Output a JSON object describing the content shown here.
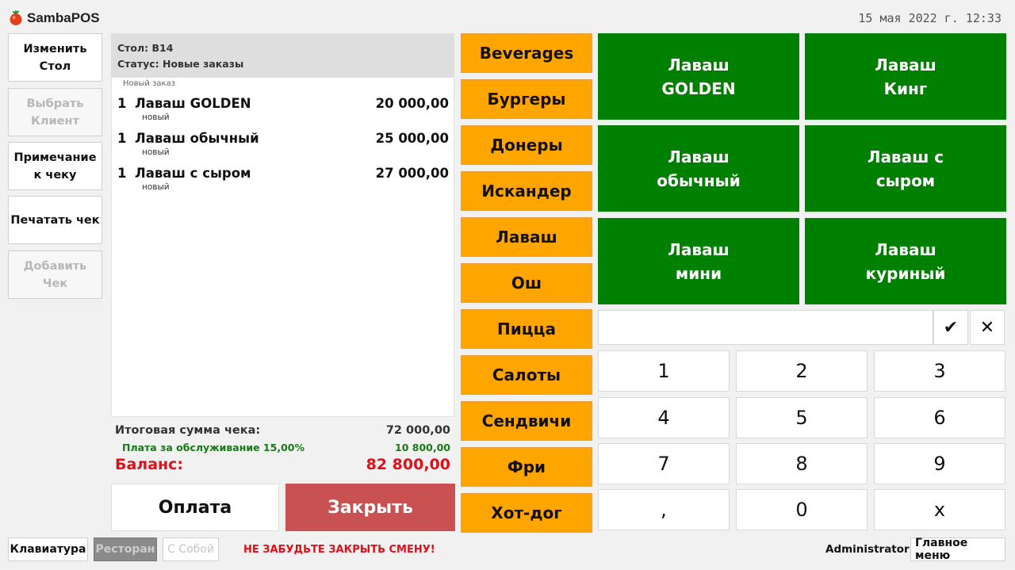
{
  "app": {
    "name": "SambaPOS",
    "logo_icon": "tomato-icon",
    "datetime": "15 мая 2022 г. 12:33"
  },
  "actions": [
    {
      "label": "Изменить\nСтол",
      "enabled": true
    },
    {
      "label": "Выбрать\nКлиент",
      "enabled": false
    },
    {
      "label": "Примечание\nк чеку",
      "enabled": true
    },
    {
      "label": "Печатать чек",
      "enabled": true
    },
    {
      "label": "Добавить\nЧек",
      "enabled": false
    }
  ],
  "ticket": {
    "table": "Стол: B14",
    "status": "Статус: Новые заказы",
    "order_group": "Новый заказ",
    "lines": [
      {
        "qty": "1",
        "name": "Лаваш GOLDEN",
        "price": "20 000,00",
        "state": "новый"
      },
      {
        "qty": "1",
        "name": "Лаваш обычный",
        "price": "25 000,00",
        "state": "новый"
      },
      {
        "qty": "1",
        "name": "Лаваш с сыром",
        "price": "27 000,00",
        "state": "новый"
      }
    ],
    "total_label": "Итоговая сумма чека:",
    "total_value": "72 000,00",
    "fee_label": "Плата за обслуживание 15,00%",
    "fee_value": "10 800,00",
    "balance_label": "Баланс:",
    "balance_value": "82 800,00"
  },
  "buttons": {
    "pay": "Оплата",
    "close": "Закрыть"
  },
  "categories": [
    "Beverages",
    "Бургеры",
    "Донеры",
    "Искандер",
    "Лаваш",
    "Ош",
    "Пицца",
    "Салоты",
    "Сендвичи",
    "Фри",
    "Хот-дог"
  ],
  "products": [
    "Лаваш\nGOLDEN",
    "Лаваш\nКинг",
    "Лаваш\nобычный",
    "Лаваш с\nсыром",
    "Лаваш\nмини",
    "Лаваш\nкуриный"
  ],
  "numpad": {
    "input_value": "",
    "ok_icon": "checkmark-icon",
    "ok_glyph": "✔",
    "cancel_icon": "close-icon",
    "cancel_glyph": "✕",
    "keys": [
      "1",
      "2",
      "3",
      "4",
      "5",
      "6",
      "7",
      "8",
      "9",
      ",",
      "0",
      "x"
    ]
  },
  "bottom": {
    "keyboard": "Клавиатура",
    "restaurant": "Ресторан",
    "takeaway": "С Собой",
    "warning": "НЕ ЗАБУДЬТЕ ЗАКРЫТЬ СМЕНУ!",
    "user": "Administrator",
    "main_menu": "Главное меню"
  },
  "colors": {
    "category": "#ffa500",
    "product": "#008000",
    "close": "#c95151",
    "balance": "#e0101a",
    "fee": "#177a17"
  }
}
